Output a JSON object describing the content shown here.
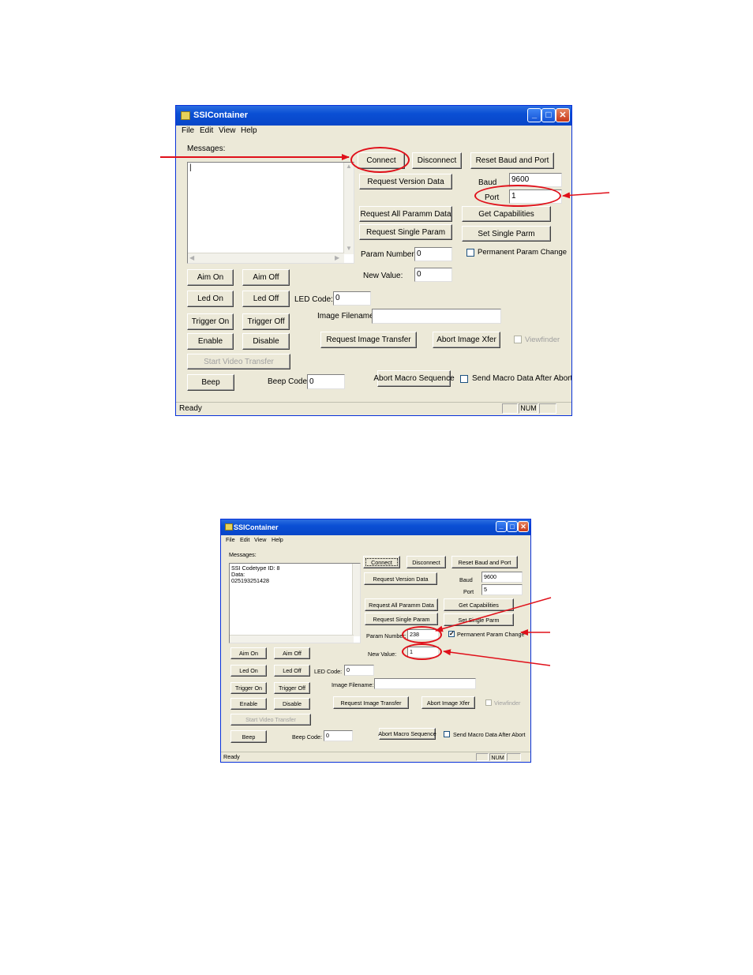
{
  "window": {
    "title": "SSIContainer",
    "menu": [
      "File",
      "Edit",
      "View",
      "Help"
    ],
    "minimize_glyph": "_",
    "maximize_glyph": "□",
    "close_glyph": "✕",
    "icon": "app-icon"
  },
  "labels": {
    "messages": "Messages:",
    "baud": "Baud",
    "port": "Port",
    "param_number": "Param Number:",
    "new_value": "New Value:",
    "led_code": "LED Code:",
    "image_filename": "Image Filename:",
    "beep_code": "Beep Code:"
  },
  "buttons": {
    "connect": "Connect",
    "disconnect": "Disconnect",
    "reset_baud_port": "Reset Baud and Port",
    "request_version": "Request Version Data",
    "request_all_param": "Request All Paramm Data",
    "get_capabilities": "Get Capabilities",
    "request_single_param": "Request Single Param",
    "set_single_parm": "Set Single Parm",
    "aim_on": "Aim On",
    "aim_off": "Aim Off",
    "led_on": "Led On",
    "led_off": "Led Off",
    "trigger_on": "Trigger On",
    "trigger_off": "Trigger Off",
    "enable": "Enable",
    "disable": "Disable",
    "request_image": "Request Image Transfer",
    "abort_image": "Abort Image Xfer",
    "start_video": "Start Video Transfer",
    "beep": "Beep",
    "abort_macro": "Abort Macro Sequence"
  },
  "checkboxes": {
    "permanent_param": "Permanent Param Change",
    "viewfinder": "Viewfinder",
    "send_macro": "Send Macro Data After Abort"
  },
  "status": {
    "text": "Ready",
    "num": "NUM"
  },
  "screen1": {
    "messages": [
      "|"
    ],
    "baud": "9600",
    "port": "1",
    "param_number": "0",
    "new_value": "0",
    "led_code": "0",
    "image_filename": "",
    "beep_code": "0",
    "permanent_checked": false
  },
  "screen2": {
    "messages": [
      "SSI Codetype ID: 8",
      "Data:",
      "025193251428"
    ],
    "baud": "9600",
    "port": "5",
    "param_number": "238",
    "new_value": "1",
    "led_code": "0",
    "image_filename": "",
    "beep_code": "0",
    "permanent_checked": true
  },
  "annotation_color": "#e0101a",
  "check_glyph": "✓"
}
